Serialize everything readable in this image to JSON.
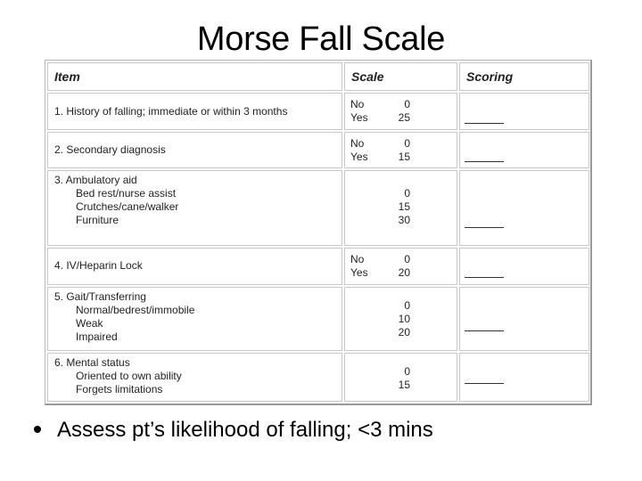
{
  "slide": {
    "title": "Morse Fall Scale",
    "bullet": "Assess pt’s likelihood of falling; <3 mins"
  },
  "table": {
    "headers": {
      "item": "Item",
      "scale": "Scale",
      "scoring": "Scoring"
    },
    "rows": [
      {
        "item": "1. History of falling; immediate or within 3 months",
        "subitems": [],
        "scale": [
          {
            "label": "No",
            "value": "0"
          },
          {
            "label": "Yes",
            "value": "25"
          }
        ],
        "scoring": ""
      },
      {
        "item": "2. Secondary diagnosis",
        "subitems": [],
        "scale": [
          {
            "label": "No",
            "value": "0"
          },
          {
            "label": "Yes",
            "value": "15"
          }
        ],
        "scoring": ""
      },
      {
        "item": "3. Ambulatory aid",
        "subitems": [
          "Bed rest/nurse assist",
          "Crutches/cane/walker",
          "Furniture"
        ],
        "scale": [
          {
            "label": "",
            "value": "0"
          },
          {
            "label": "",
            "value": "15"
          },
          {
            "label": "",
            "value": "30"
          }
        ],
        "scoring": ""
      },
      {
        "item": "4. IV/Heparin Lock",
        "subitems": [],
        "scale": [
          {
            "label": "No",
            "value": "0"
          },
          {
            "label": "Yes",
            "value": "20"
          }
        ],
        "scoring": ""
      },
      {
        "item": "5. Gait/Transferring",
        "subitems": [
          "Normal/bedrest/immobile",
          "Weak",
          "Impaired"
        ],
        "scale": [
          {
            "label": "",
            "value": "0"
          },
          {
            "label": "",
            "value": "10"
          },
          {
            "label": "",
            "value": "20"
          }
        ],
        "scoring": ""
      },
      {
        "item": "6. Mental status",
        "subitems": [
          "Oriented to own ability",
          "Forgets limitations"
        ],
        "scale": [
          {
            "label": "",
            "value": "0"
          },
          {
            "label": "",
            "value": "15"
          }
        ],
        "scoring": ""
      }
    ]
  }
}
